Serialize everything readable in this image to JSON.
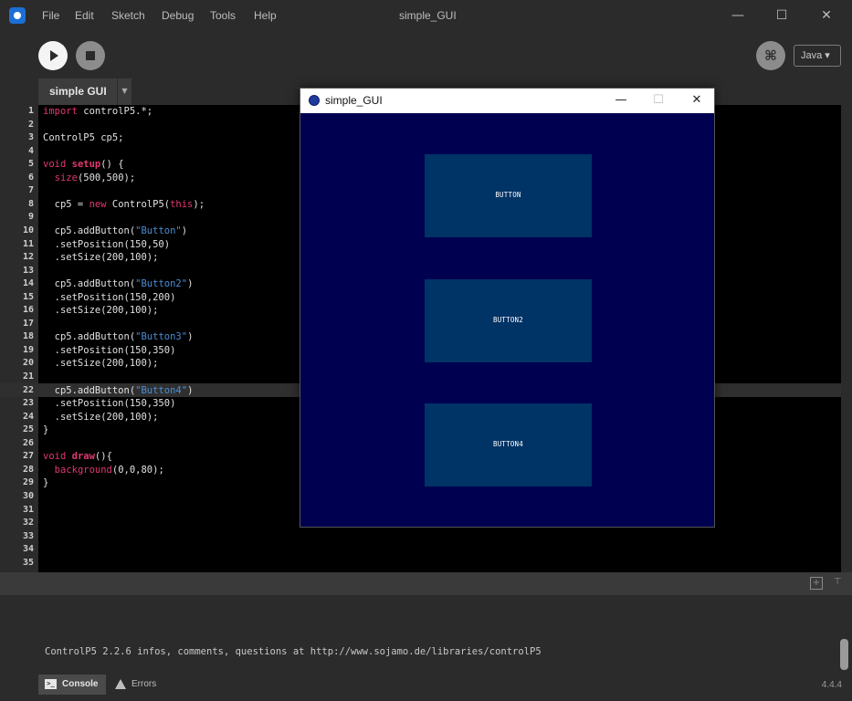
{
  "menu": {
    "items": [
      "File",
      "Edit",
      "Sketch",
      "Debug",
      "Tools",
      "Help"
    ],
    "window_title": "simple_GUI",
    "minimize": "—",
    "maximize": "☐",
    "close": "✕"
  },
  "toolbar": {
    "run_label": "",
    "stop_label": "",
    "debug_icon": "bug-icon",
    "debug_glyph": "⌘",
    "mode": "Java ▾"
  },
  "tabs": {
    "active": "simple GUI",
    "menu_glyph": "▼"
  },
  "editor": {
    "current_line": 22,
    "lines": [
      {
        "n": "1",
        "html": "<span class='kw'>import</span> controlP5.*;"
      },
      {
        "n": "2",
        "html": ""
      },
      {
        "n": "3",
        "html": "ControlP5 cp5;"
      },
      {
        "n": "4",
        "html": ""
      },
      {
        "n": "5",
        "html": "<span class='kw'>void</span> <span class='fn'>setup</span>() {"
      },
      {
        "n": "6",
        "html": "  <span class='kw'>size</span>(500,500);"
      },
      {
        "n": "7",
        "html": ""
      },
      {
        "n": "8",
        "html": "  cp5 = <span class='kw'>new</span> ControlP5(<span class='kw'>this</span>);"
      },
      {
        "n": "9",
        "html": ""
      },
      {
        "n": "10",
        "html": "  cp5.addButton(<span class='str'>\"Button\"</span>)"
      },
      {
        "n": "11",
        "html": "  .setPosition(150,50)"
      },
      {
        "n": "12",
        "html": "  .setSize(200,100);"
      },
      {
        "n": "13",
        "html": ""
      },
      {
        "n": "14",
        "html": "  cp5.addButton(<span class='str'>\"Button2\"</span>)"
      },
      {
        "n": "15",
        "html": "  .setPosition(150,200)"
      },
      {
        "n": "16",
        "html": "  .setSize(200,100);"
      },
      {
        "n": "17",
        "html": ""
      },
      {
        "n": "18",
        "html": "  cp5.addButton(<span class='str'>\"Button3\"</span>)"
      },
      {
        "n": "19",
        "html": "  .setPosition(150,350)"
      },
      {
        "n": "20",
        "html": "  .setSize(200,100);"
      },
      {
        "n": "21",
        "html": ""
      },
      {
        "n": "22",
        "html": "  cp5.addButton(<span class='str'>\"Button4\"</span>)"
      },
      {
        "n": "23",
        "html": "  .setPosition(150,350)"
      },
      {
        "n": "24",
        "html": "  .setSize(200,100);"
      },
      {
        "n": "25",
        "html": "}"
      },
      {
        "n": "26",
        "html": ""
      },
      {
        "n": "27",
        "html": "<span class='kw'>void</span> <span class='fn'>draw</span>(){"
      },
      {
        "n": "28",
        "html": "  <span class='kw'>background</span>(0,0,80);"
      },
      {
        "n": "29",
        "html": "}"
      },
      {
        "n": "30",
        "html": ""
      },
      {
        "n": "31",
        "html": ""
      },
      {
        "n": "32",
        "html": ""
      },
      {
        "n": "33",
        "html": ""
      },
      {
        "n": "34",
        "html": ""
      },
      {
        "n": "35",
        "html": ""
      }
    ]
  },
  "sketch": {
    "title": "simple_GUI",
    "minimize": "—",
    "maximize": "☐",
    "close": "✕",
    "background": "#000050",
    "buttons": [
      {
        "label": "BUTTON"
      },
      {
        "label": "BUTTON2"
      },
      {
        "label": "BUTTON4"
      }
    ]
  },
  "console": {
    "message": "ControlP5 2.2.6 infos, comments, questions at http://www.sojamo.de/libraries/controlP5",
    "tab_console": "Console",
    "tab_errors": "Errors",
    "version": "4.4.4"
  },
  "colors": {
    "editor_bg": "#000000",
    "chrome_bg": "#2b2b2b",
    "keyword": "#e2386e",
    "string": "#4b8ed6",
    "p5_button": "#003366"
  }
}
